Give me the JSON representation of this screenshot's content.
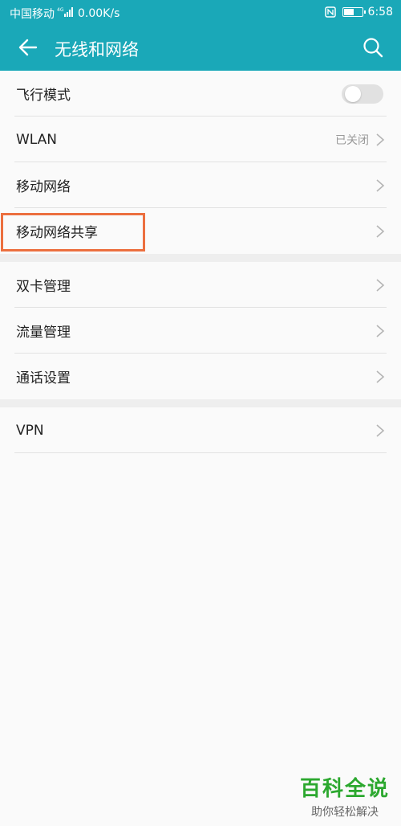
{
  "status": {
    "carrier": "中国移动",
    "net": "4G",
    "speed": "0.00K/s",
    "time": "6:58",
    "battery_level": 0.6
  },
  "header": {
    "title": "无线和网络"
  },
  "groups": [
    [
      {
        "label": "飞行模式",
        "type": "toggle",
        "on": false
      },
      {
        "label": "WLAN",
        "value": "已关闭",
        "type": "nav"
      },
      {
        "label": "移动网络",
        "type": "nav"
      },
      {
        "label": "移动网络共享",
        "type": "nav"
      }
    ],
    [
      {
        "label": "双卡管理",
        "type": "nav"
      },
      {
        "label": "流量管理",
        "type": "nav"
      },
      {
        "label": "通话设置",
        "type": "nav"
      }
    ],
    [
      {
        "label": "VPN",
        "type": "nav"
      }
    ]
  ],
  "watermark": {
    "title": "百科全说",
    "subtitle": "助你轻松解决"
  }
}
